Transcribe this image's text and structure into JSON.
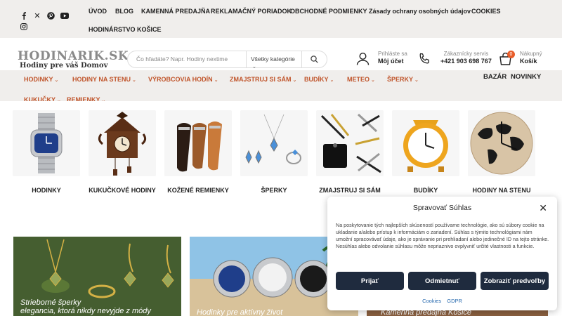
{
  "topbar": {
    "social": [
      "facebook-icon",
      "x-icon",
      "pinterest-icon",
      "youtube-icon",
      "instagram-icon"
    ],
    "links": [
      "ÚVOD",
      "BLOG",
      "KAMENNÁ PREDAJŇA",
      "REKLAMAČNÝ PORIADOK",
      "OBCHODNÉ PODMIENKY",
      "Zásady ochrany osobných údajov",
      "COOKIES",
      "HODINÁRSTVO KOŠICE"
    ]
  },
  "header": {
    "logo_main": "HODINARIK.SK",
    "logo_sub": "Hodiny pre váš Domov",
    "search_placeholder": "Čo hľadáte? Napr. Hodiny nextime",
    "search_category": "Všetky kategórie",
    "account_line1": "Prihláste sa",
    "account_line2": "Môj účet",
    "service_line1": "Zákaznícky servis",
    "service_line2": "+421 903 698 767",
    "cart_line1": "Nákupný",
    "cart_line2": "Košík",
    "cart_count": "0"
  },
  "mainnav": {
    "items": [
      "HODINKY",
      "HODINY NA STENU",
      "VÝROBCOVIA HODÍN",
      "ZMAJSTRUJ SI SÁM",
      "BUDÍKY",
      "METEO",
      "ŠPERKY",
      "KUKUČKY",
      "REMIENKY"
    ],
    "right": [
      "BAZÁR",
      "NOVINKY"
    ]
  },
  "categories": [
    {
      "label": "HODINKY"
    },
    {
      "label": "KUKUČKOVÉ HODINY"
    },
    {
      "label": "KOŽENÉ REMIENKY"
    },
    {
      "label": "ŠPERKY"
    },
    {
      "label": "ZMAJSTRUJ SI SÁM"
    },
    {
      "label": "BUDÍKY"
    },
    {
      "label": "HODINY NA STENU"
    }
  ],
  "banners": [
    {
      "caption_line1": "Strieborné šperky",
      "caption_line2": "elegancia, ktorá nikdy nevyjde z módy"
    },
    {
      "caption_line1": "Hodinky pre aktívny život",
      "caption_line2": ""
    },
    {
      "caption_line1": "Kamenná predajňa Košice",
      "caption_line2": ""
    }
  ],
  "cookie": {
    "title": "Spravovať Súhlas",
    "text": "Na poskytovanie tých najlepších skúseností používame technológie, ako sú súbory cookie na ukladanie a/alebo prístup k informáciám o zariadení. Súhlas s týmito technológiami nám umožní spracovávať údaje, ako je správanie pri prehliadaní alebo jedinečné ID na tejto stránke. Nesúhlas alebo odvolanie súhlasu môže nepriaznivo ovplyvniť určité vlastnosti a funkcie.",
    "accept": "Prijať",
    "deny": "Odmietnuť",
    "preferences": "Zobraziť predvoľby",
    "link_cookies": "Cookies",
    "link_gdpr": "GDPR"
  }
}
